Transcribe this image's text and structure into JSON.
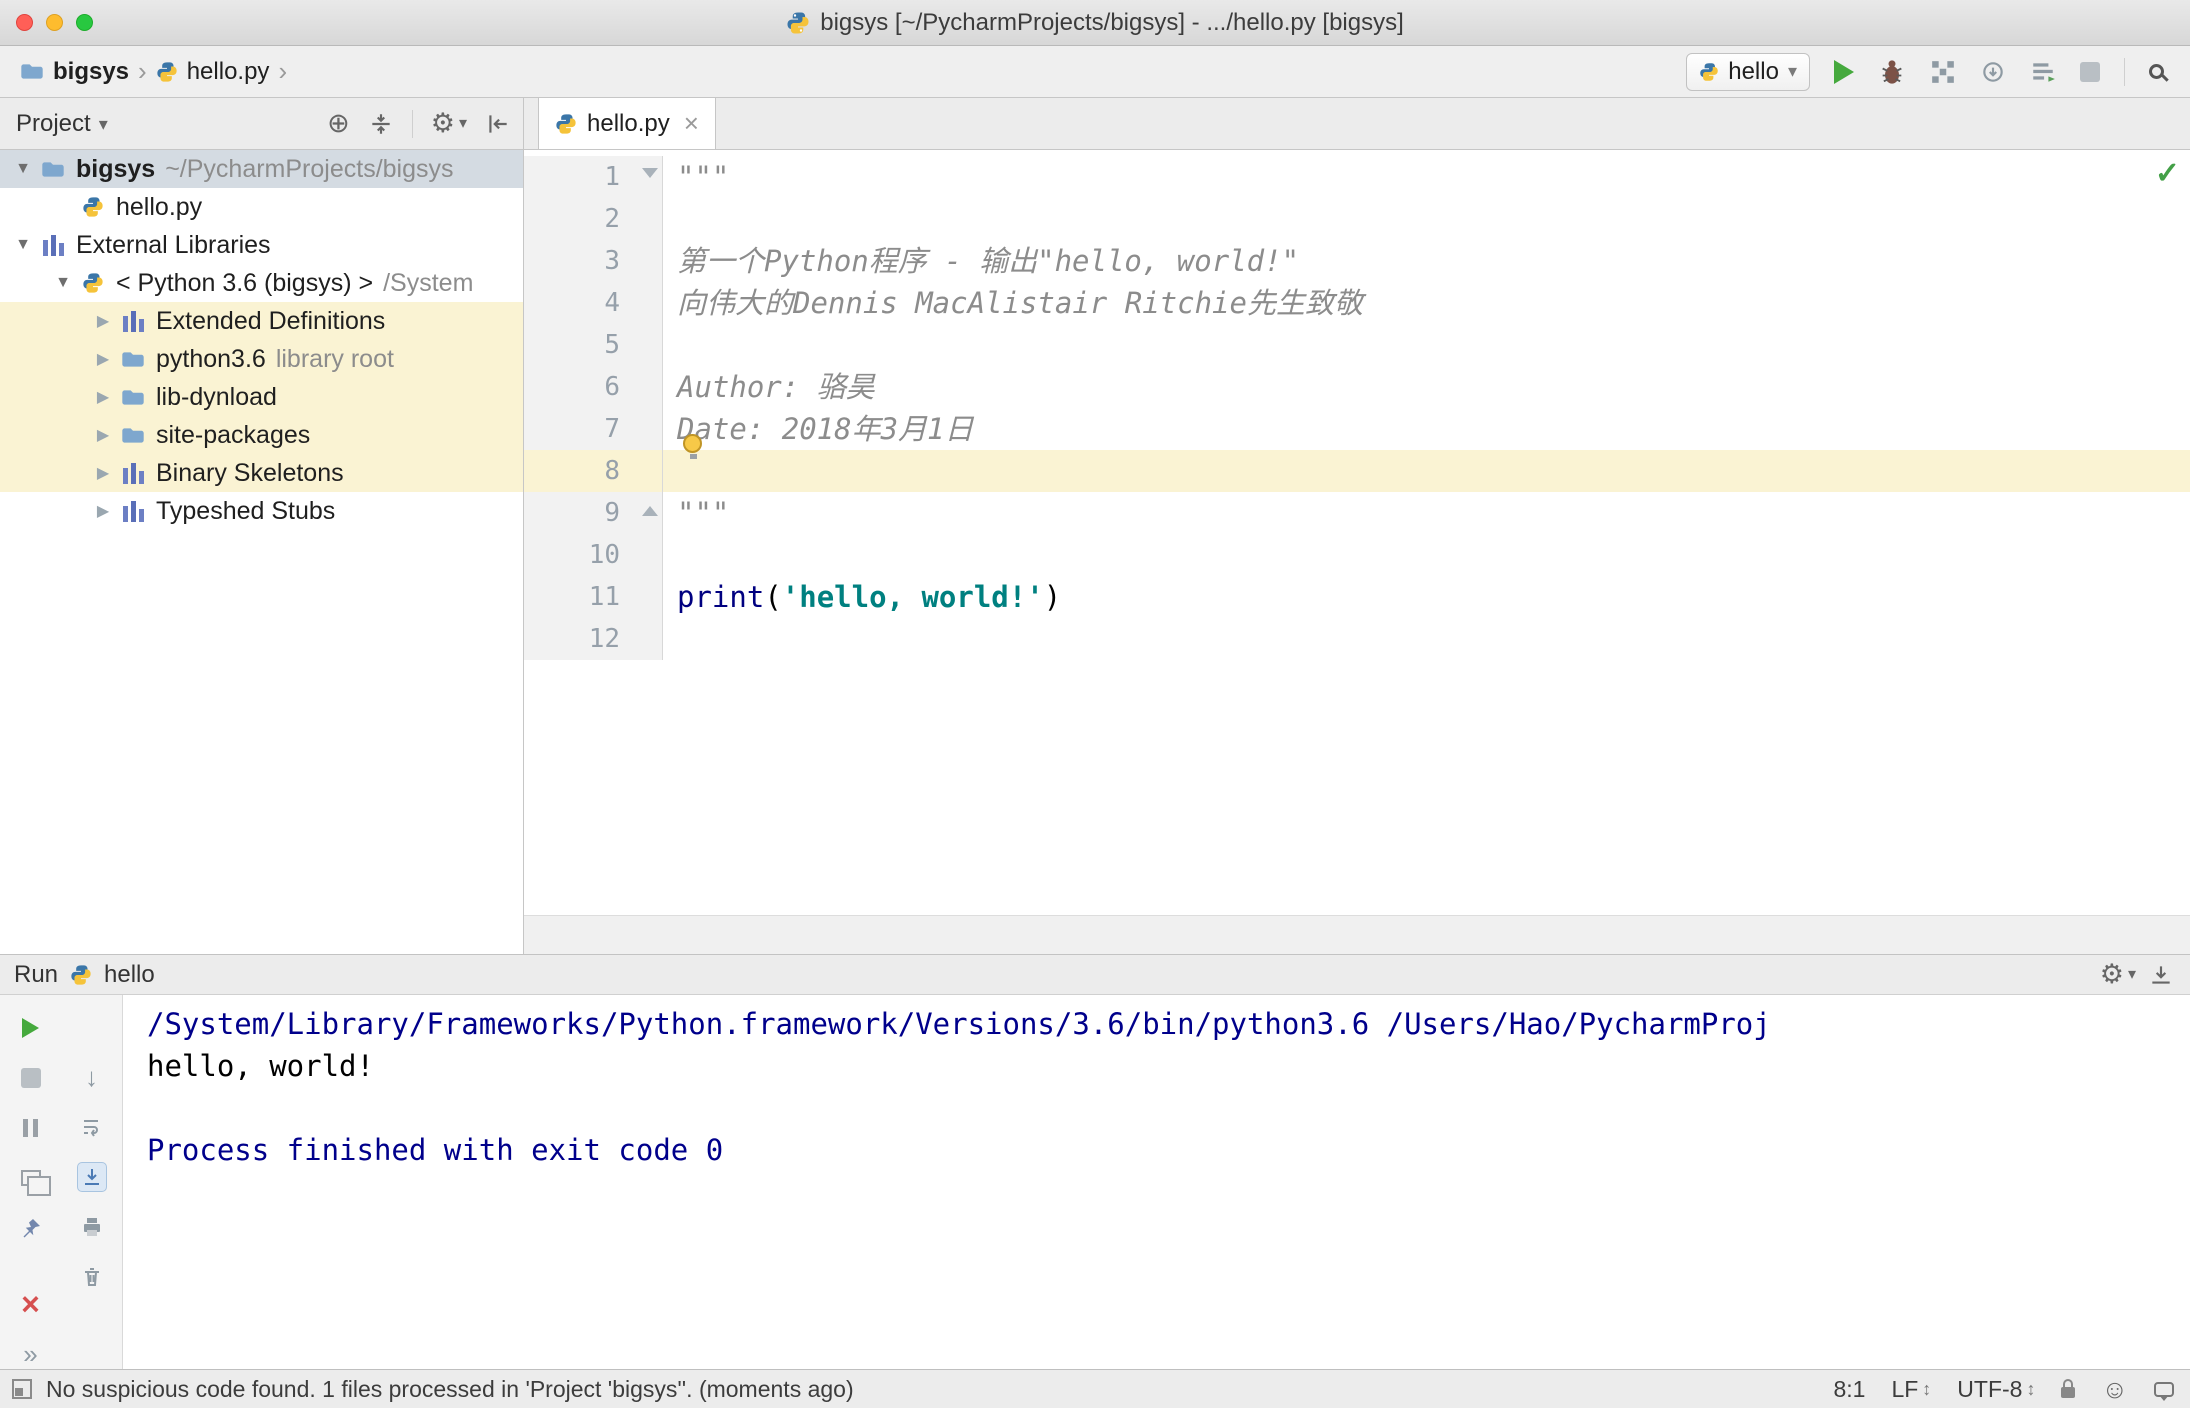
{
  "titlebar": {
    "title": "bigsys [~/PycharmProjects/bigsys] - .../hello.py [bigsys]"
  },
  "navbar": {
    "breadcrumb": {
      "project": "bigsys",
      "file": "hello.py"
    },
    "run_config": {
      "label": "hello"
    }
  },
  "project_panel": {
    "header_label": "Project",
    "tree": [
      {
        "label": "bigsys",
        "suffix": "~/PycharmProjects/bigsys",
        "icon": "folder",
        "chevron": "expanded",
        "level": 0,
        "selected": true
      },
      {
        "label": "hello.py",
        "icon": "python",
        "chevron": "none",
        "level": 1
      },
      {
        "label": "External Libraries",
        "icon": "library",
        "chevron": "expanded",
        "level": 0
      },
      {
        "label": "< Python 3.6 (bigsys) >",
        "suffix": "/System",
        "icon": "python",
        "chevron": "expanded",
        "level": 1
      },
      {
        "label": "Extended Definitions",
        "icon": "library",
        "chevron": "collapsed",
        "level": 2,
        "highlighted": true
      },
      {
        "label": "python3.6",
        "suffix": "library root",
        "icon": "folder",
        "chevron": "collapsed",
        "level": 2,
        "highlighted": true
      },
      {
        "label": "lib-dynload",
        "icon": "folder",
        "chevron": "collapsed",
        "level": 2,
        "highlighted": true
      },
      {
        "label": "site-packages",
        "icon": "folder",
        "chevron": "collapsed",
        "level": 2,
        "highlighted": true
      },
      {
        "label": "Binary Skeletons",
        "icon": "library",
        "chevron": "collapsed",
        "level": 2,
        "highlighted": true
      },
      {
        "label": "Typeshed Stubs",
        "icon": "library",
        "chevron": "collapsed",
        "level": 2
      }
    ]
  },
  "editor": {
    "tab_label": "hello.py",
    "current_line": 8,
    "lines": [
      {
        "n": 1,
        "fold": "start",
        "segments": [
          {
            "text": "\"\"\"",
            "style": "docstring"
          }
        ]
      },
      {
        "n": 2,
        "segments": []
      },
      {
        "n": 3,
        "segments": [
          {
            "text": "第一个Python程序 - 输出\"hello, world!\"",
            "style": "docstring"
          }
        ]
      },
      {
        "n": 4,
        "segments": [
          {
            "text": "向伟大的Dennis MacAlistair Ritchie先生致敬",
            "style": "docstring"
          }
        ]
      },
      {
        "n": 5,
        "segments": []
      },
      {
        "n": 6,
        "segments": [
          {
            "text": "Author: 骆昊",
            "style": "docstring"
          }
        ]
      },
      {
        "n": 7,
        "bulb": true,
        "segments": [
          {
            "text": "Date: 2018年3月1日",
            "style": "docstring"
          }
        ]
      },
      {
        "n": 8,
        "segments": []
      },
      {
        "n": 9,
        "fold": "end",
        "segments": [
          {
            "text": "\"\"\"",
            "style": "docstring"
          }
        ]
      },
      {
        "n": 10,
        "segments": []
      },
      {
        "n": 11,
        "segments": [
          {
            "text": "print",
            "style": "keyword"
          },
          {
            "text": "(",
            "style": "plain"
          },
          {
            "text": "'hello, world!'",
            "style": "string"
          },
          {
            "text": ")",
            "style": "plain"
          }
        ]
      },
      {
        "n": 12,
        "segments": []
      }
    ]
  },
  "run_panel": {
    "title": "Run",
    "config_label": "hello",
    "console_lines": [
      {
        "text": "/System/Library/Frameworks/Python.framework/Versions/3.6/bin/python3.6 /Users/Hao/PycharmProj",
        "style": "system"
      },
      {
        "text": "hello, world!",
        "style": "stdout"
      },
      {
        "text": "",
        "style": "stdout"
      },
      {
        "text": "Process finished with exit code 0",
        "style": "system"
      }
    ]
  },
  "statusbar": {
    "message": "No suspicious code found. 1 files processed in 'Project 'bigsys''. (moments ago)",
    "caret_position": "8:1",
    "line_separator": "LF",
    "encoding": "UTF-8"
  },
  "icons": {
    "gear": "⚙",
    "dropdown_arrow": "▾",
    "breadcrumb_separator": "›",
    "close_tab": "×",
    "check": "✓",
    "locate": "⊕",
    "scroll_down": "↓",
    "close_red": "×",
    "more": "»",
    "updown": "↕",
    "hector": "☺",
    "expanded_chevron": "▼",
    "collapsed_chevron": "▶"
  }
}
